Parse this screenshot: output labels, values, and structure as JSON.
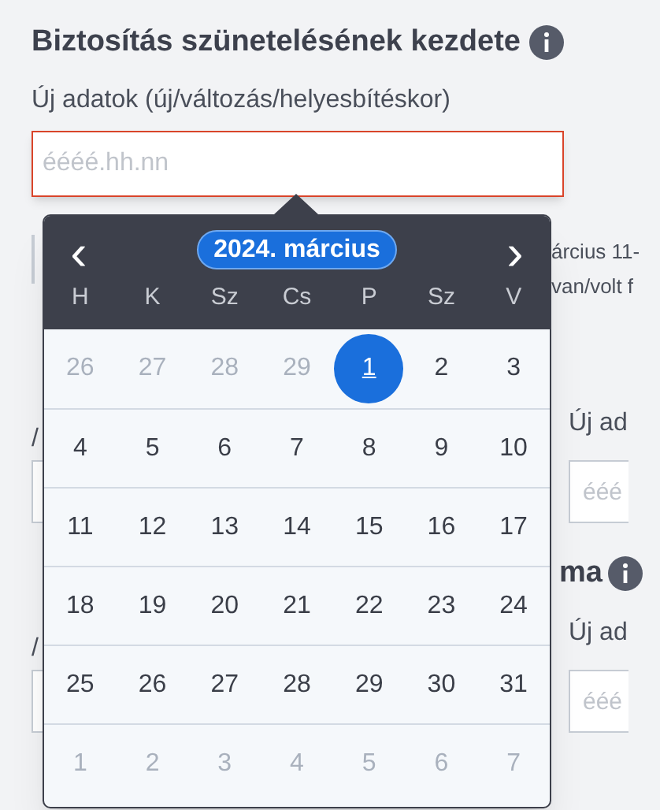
{
  "section_1": {
    "title": "Biztosítás szünetelésének kezdete",
    "field_label": "Új adatok (új/változás/helyesbítéskor)",
    "field": {
      "placeholder": "éééé.hh.nn"
    }
  },
  "note_lines": [
    "árcius 11-",
    "van/volt f"
  ],
  "section_2": {
    "left_label": "/",
    "right_label": "Új ad",
    "right_field": {
      "placeholder": "ééé"
    }
  },
  "section_3": {
    "title_end": "ma",
    "left_label": "/",
    "right_label": "Új ad",
    "right_field": {
      "placeholder": "ééé"
    }
  },
  "datepicker": {
    "prev": "‹",
    "next": "›",
    "month": "2024. március",
    "weekdays": [
      "H",
      "K",
      "Sz",
      "Cs",
      "P",
      "Sz",
      "V"
    ],
    "weeks": [
      [
        {
          "day": "26",
          "outside": true,
          "selected": false
        },
        {
          "day": "27",
          "outside": true,
          "selected": false
        },
        {
          "day": "28",
          "outside": true,
          "selected": false
        },
        {
          "day": "29",
          "outside": true,
          "selected": false
        },
        {
          "day": "1",
          "outside": false,
          "selected": true
        },
        {
          "day": "2",
          "outside": false,
          "selected": false
        },
        {
          "day": "3",
          "outside": false,
          "selected": false
        }
      ],
      [
        {
          "day": "4",
          "outside": false,
          "selected": false
        },
        {
          "day": "5",
          "outside": false,
          "selected": false
        },
        {
          "day": "6",
          "outside": false,
          "selected": false
        },
        {
          "day": "7",
          "outside": false,
          "selected": false
        },
        {
          "day": "8",
          "outside": false,
          "selected": false
        },
        {
          "day": "9",
          "outside": false,
          "selected": false
        },
        {
          "day": "10",
          "outside": false,
          "selected": false
        }
      ],
      [
        {
          "day": "11",
          "outside": false,
          "selected": false
        },
        {
          "day": "12",
          "outside": false,
          "selected": false
        },
        {
          "day": "13",
          "outside": false,
          "selected": false
        },
        {
          "day": "14",
          "outside": false,
          "selected": false
        },
        {
          "day": "15",
          "outside": false,
          "selected": false
        },
        {
          "day": "16",
          "outside": false,
          "selected": false
        },
        {
          "day": "17",
          "outside": false,
          "selected": false
        }
      ],
      [
        {
          "day": "18",
          "outside": false,
          "selected": false
        },
        {
          "day": "19",
          "outside": false,
          "selected": false
        },
        {
          "day": "20",
          "outside": false,
          "selected": false
        },
        {
          "day": "21",
          "outside": false,
          "selected": false
        },
        {
          "day": "22",
          "outside": false,
          "selected": false
        },
        {
          "day": "23",
          "outside": false,
          "selected": false
        },
        {
          "day": "24",
          "outside": false,
          "selected": false
        }
      ],
      [
        {
          "day": "25",
          "outside": false,
          "selected": false
        },
        {
          "day": "26",
          "outside": false,
          "selected": false
        },
        {
          "day": "27",
          "outside": false,
          "selected": false
        },
        {
          "day": "28",
          "outside": false,
          "selected": false
        },
        {
          "day": "29",
          "outside": false,
          "selected": false
        },
        {
          "day": "30",
          "outside": false,
          "selected": false
        },
        {
          "day": "31",
          "outside": false,
          "selected": false
        }
      ],
      [
        {
          "day": "1",
          "outside": true,
          "selected": false
        },
        {
          "day": "2",
          "outside": true,
          "selected": false
        },
        {
          "day": "3",
          "outside": true,
          "selected": false
        },
        {
          "day": "4",
          "outside": true,
          "selected": false
        },
        {
          "day": "5",
          "outside": true,
          "selected": false
        },
        {
          "day": "6",
          "outside": true,
          "selected": false
        },
        {
          "day": "7",
          "outside": true,
          "selected": false
        }
      ]
    ]
  }
}
